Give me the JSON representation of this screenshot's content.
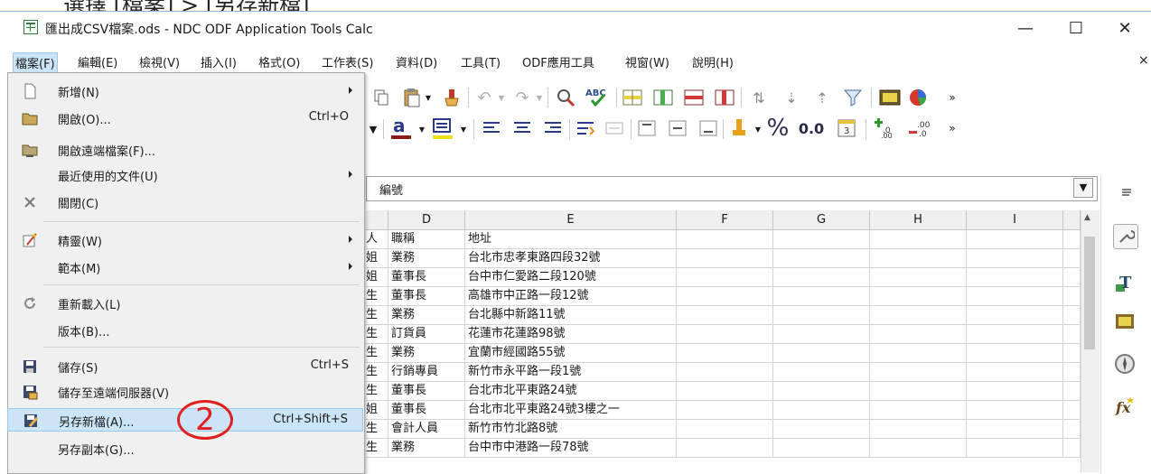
{
  "top_fragment": "選擇 [檔案] > [另存新檔]",
  "window": {
    "title": "匯出成CSV檔案.ods - NDC ODF Application Tools Calc",
    "minimize_glyph": "—",
    "maximize_glyph": "☐",
    "close_glyph": "✕"
  },
  "menubar": {
    "items": [
      "檔案(F)",
      "編輯(E)",
      "檢視(V)",
      "插入(I)",
      "格式(O)",
      "工作表(S)",
      "資料(D)",
      "工具(T)",
      "ODF應用工具",
      "視窗(W)",
      "說明(H)"
    ],
    "close_doc_glyph": "×"
  },
  "formula_bar": {
    "content": "編號",
    "dropdown_glyph": "▼"
  },
  "toolbar": {
    "percent_label": "%",
    "decimal_label": "0.0",
    "overflow_glyph": "»"
  },
  "sheet": {
    "columns": [
      "D",
      "E",
      "F",
      "G",
      "H",
      "I"
    ],
    "partial_c": [
      "人",
      "姐",
      "姐",
      "生",
      "生",
      "生",
      "生",
      "生",
      "生",
      "姐",
      "生",
      "生"
    ],
    "rows": [
      [
        "職稱",
        "地址"
      ],
      [
        "業務",
        "台北市忠孝東路四段32號"
      ],
      [
        "董事長",
        "台中市仁愛路二段120號"
      ],
      [
        "董事長",
        "高雄市中正路一段12號"
      ],
      [
        "業務",
        "台北縣中新路11號"
      ],
      [
        "訂貨員",
        "花蓮市花蓮路98號"
      ],
      [
        "業務",
        "宜蘭市經國路55號"
      ],
      [
        "行銷專員",
        "新竹市永平路一段1號"
      ],
      [
        "董事長",
        "台北市北平東路24號"
      ],
      [
        "董事長",
        "台北市北平東路24號3樓之一"
      ],
      [
        "會計人員",
        "新竹市竹北路8號"
      ],
      [
        "業務",
        "台中市中港路一段78號"
      ]
    ]
  },
  "file_menu": {
    "items": [
      {
        "label": "新增(N)",
        "shortcut": "",
        "submenu": true,
        "icon": "new-document-icon"
      },
      {
        "label": "開啟(O)...",
        "shortcut": "Ctrl+O",
        "submenu": false,
        "icon": "open-folder-icon"
      },
      {
        "label": "開啟遠端檔案(F)...",
        "shortcut": "",
        "submenu": false,
        "icon": "remote-folder-icon"
      },
      {
        "label": "最近使用的文件(U)",
        "shortcut": "",
        "submenu": true,
        "icon": ""
      },
      {
        "label": "關閉(C)",
        "shortcut": "",
        "submenu": false,
        "icon": "close-x-icon"
      },
      {
        "label": "精靈(W)",
        "shortcut": "",
        "submenu": true,
        "icon": "wizard-icon"
      },
      {
        "label": "範本(M)",
        "shortcut": "",
        "submenu": true,
        "icon": ""
      },
      {
        "label": "重新載入(L)",
        "shortcut": "",
        "submenu": false,
        "icon": "reload-icon"
      },
      {
        "label": "版本(B)...",
        "shortcut": "",
        "submenu": false,
        "icon": ""
      },
      {
        "label": "儲存(S)",
        "shortcut": "Ctrl+S",
        "submenu": false,
        "icon": "save-icon"
      },
      {
        "label": "儲存至遠端伺服器(V)",
        "shortcut": "",
        "submenu": false,
        "icon": "save-remote-icon"
      },
      {
        "label": "另存新檔(A)...",
        "shortcut": "Ctrl+Shift+S",
        "submenu": false,
        "icon": "save-as-icon",
        "highlighted": true
      },
      {
        "label": "另存副本(G)...",
        "shortcut": "",
        "submenu": false,
        "icon": ""
      }
    ]
  },
  "annotation": {
    "step_number": "2",
    "color": "#e02020"
  },
  "colors": {
    "highlight": "#cce4f7",
    "menu_bg": "#f0f0f0",
    "accent_red": "#e02020"
  }
}
